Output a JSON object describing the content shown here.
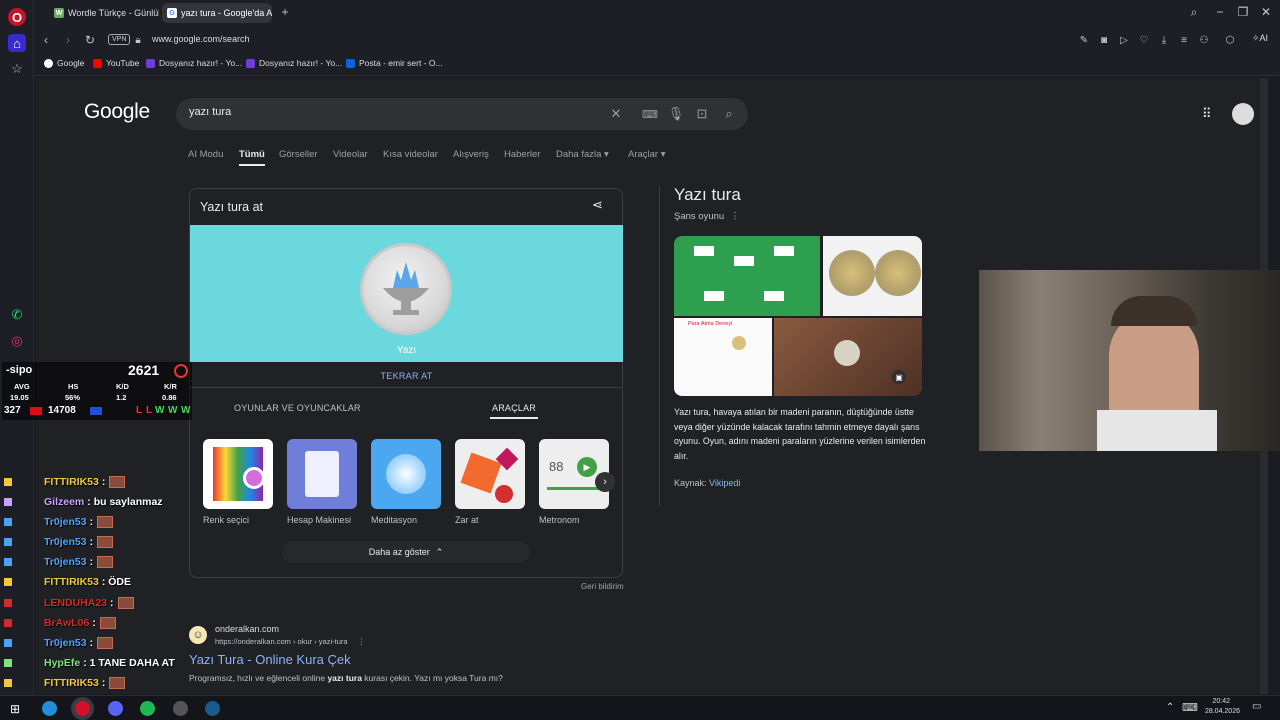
{
  "browser": {
    "tabs": [
      {
        "label": "Wordle Türkçe - Günlük K",
        "active": false
      },
      {
        "label": "yazı tura - Google'da Ara",
        "active": true
      }
    ],
    "vpn_label": "VPN",
    "url": "www.google.com/search",
    "ai_label": "AI",
    "bookmarks": [
      {
        "label": "Google"
      },
      {
        "label": "YouTube"
      },
      {
        "label": "Dosyanız hazır! - Yo..."
      },
      {
        "label": "Dosyanız hazır! - Yo..."
      },
      {
        "label": "Posta - emir sert - O..."
      }
    ]
  },
  "google": {
    "logo": "Google",
    "query": "yazı tura",
    "tabs": [
      {
        "label": "AI Modu"
      },
      {
        "label": "Tümü"
      },
      {
        "label": "Görseller"
      },
      {
        "label": "Videolar"
      },
      {
        "label": "Kısa videolar"
      },
      {
        "label": "Alışveriş"
      },
      {
        "label": "Haberler"
      },
      {
        "label": "Daha fazla ▾"
      },
      {
        "label": "Araçlar ▾"
      }
    ],
    "coin_card": {
      "title": "Yazı tura at",
      "result_label": "Yazı",
      "flip_again": "TEKRAR AT",
      "category_tabs": [
        "OYUNLAR VE OYUNCAKLAR",
        "ARAÇLAR"
      ],
      "tools": [
        {
          "label": "Renk seçici"
        },
        {
          "label": "Hesap Makinesi"
        },
        {
          "label": "Meditasyon"
        },
        {
          "label": "Zar at"
        },
        {
          "label": "Metronom"
        }
      ],
      "metronome_value": "88",
      "show_less": "Daha az göster",
      "feedback": "Geri bildirim"
    },
    "result": {
      "site": "onderalkan.com",
      "url": "https://onderalkan.com › okur › yazi-tura",
      "title": "Yazı Tura - Online Kura Çek",
      "snippet_before": "Programsız, hızlı ve eğlenceli online ",
      "snippet_bold": "yazı tura",
      "snippet_after": " kurası çekin. Yazı mı yoksa Tura mı?"
    },
    "knowledge_panel": {
      "title": "Yazı tura",
      "subtitle": "Şans oyunu",
      "image_caption": "Para Atma Deneyi",
      "description": "Yazı tura, havaya atılan bir madeni paranın, düştüğünde üstte veya diğer yüzünde kalacak tarafını tahmin etmeye dayalı şans oyunu. Oyun, adını madeni paraların yüzlerine verilen isimlerden alır.",
      "source_label": "Kaynak:",
      "source_link": "Vikipedi"
    }
  },
  "stream": {
    "player": "-sipo",
    "score": "2621",
    "stats_headers": [
      "AVG",
      "HS",
      "K/D",
      "K/R"
    ],
    "stats_values": [
      "19.05",
      "56%",
      "1.2",
      "0.86"
    ],
    "matches": "327",
    "elo": "14708",
    "form": [
      "L",
      "L",
      "W",
      "W",
      "W"
    ],
    "chat": [
      {
        "user": "FITTIRIK53",
        "msg": ":",
        "color": "#f0c93a"
      },
      {
        "user": "Gilzeem",
        "msg": ": bu saylanmaz",
        "color": "#c8a2ff"
      },
      {
        "user": "Tr0jen53",
        "msg": ":",
        "color": "#4aa3ff"
      },
      {
        "user": "Tr0jen53",
        "msg": ":",
        "color": "#4aa3ff"
      },
      {
        "user": "Tr0jen53",
        "msg": ":",
        "color": "#4aa3ff"
      },
      {
        "user": "FITTIRIK53",
        "msg": ": ÖDE",
        "color": "#f0c93a"
      },
      {
        "user": "LENDUHA23",
        "msg": ":",
        "color": "#d12b2b"
      },
      {
        "user": "BrAwL06",
        "msg": ":",
        "color": "#d12b2b"
      },
      {
        "user": "Tr0jen53",
        "msg": ":",
        "color": "#4aa3ff"
      },
      {
        "user": "HypEfe",
        "msg": ": 1 TANE DAHA AT",
        "color": "#7be57b"
      },
      {
        "user": "FITTIRIK53",
        "msg": ":",
        "color": "#f0c93a"
      }
    ]
  },
  "taskbar": {
    "time": "20:42",
    "date": "28.04.2026"
  },
  "colors": {
    "coin_bg": "#6bd8dd",
    "link": "#8ab4f8",
    "page_bg": "#202124"
  }
}
